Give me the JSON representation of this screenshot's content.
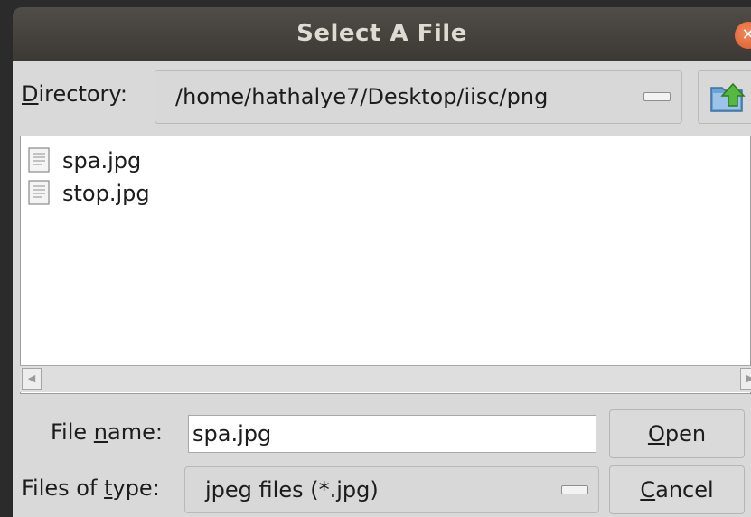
{
  "window": {
    "title": "Select A File"
  },
  "directory": {
    "label_prefix": "D",
    "label_rest": "irectory:",
    "path": "/home/hathalye7/Desktop/iisc/png"
  },
  "files": [
    {
      "name": "spa.jpg",
      "icon": "document-icon"
    },
    {
      "name": "stop.jpg",
      "icon": "document-icon"
    }
  ],
  "file_name": {
    "label_before": "File ",
    "label_accel": "n",
    "label_after": "ame:",
    "value": "spa.jpg"
  },
  "file_type": {
    "label_before": "Files of ",
    "label_accel": "t",
    "label_after": "ype:",
    "value": "jpeg files (*.jpg)"
  },
  "buttons": {
    "open_accel": "O",
    "open_rest": "pen",
    "cancel_accel": "C",
    "cancel_rest": "ancel"
  },
  "colors": {
    "titlebar": "#3c3935",
    "close": "#e05a29",
    "dialog_bg": "#d9d9d9",
    "up_arrow": "#4caf3a"
  }
}
